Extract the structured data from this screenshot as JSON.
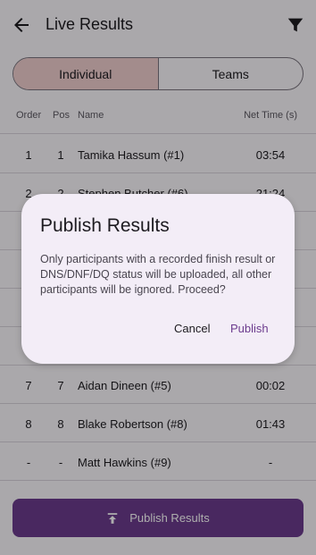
{
  "header": {
    "title": "Live Results"
  },
  "segments": {
    "individual": "Individual",
    "teams": "Teams"
  },
  "table": {
    "headers": {
      "order": "Order",
      "pos": "Pos",
      "name": "Name",
      "time": "Net Time (s)"
    },
    "rows": [
      {
        "order": "1",
        "pos": "1",
        "name": "Tamika Hassum (#1)",
        "time": "03:54"
      },
      {
        "order": "2",
        "pos": "2",
        "name": "Stephen Butcher (#6)",
        "time": "21:24"
      },
      {
        "order": "",
        "pos": "",
        "name": "",
        "time": ""
      },
      {
        "order": "",
        "pos": "",
        "name": "",
        "time": ""
      },
      {
        "order": "",
        "pos": "",
        "name": "",
        "time": ""
      },
      {
        "order": "",
        "pos": "",
        "name": "",
        "time": ""
      },
      {
        "order": "7",
        "pos": "7",
        "name": "Aidan Dineen (#5)",
        "time": "00:02"
      },
      {
        "order": "8",
        "pos": "8",
        "name": "Blake Robertson (#8)",
        "time": "01:43"
      },
      {
        "order": "-",
        "pos": "-",
        "name": "Matt Hawkins (#9)",
        "time": "-"
      }
    ]
  },
  "bottom_button": {
    "label": "Publish Results"
  },
  "dialog": {
    "title": "Publish Results",
    "body": "Only participants with a recorded finish result or DNS/DNF/DQ status will be uploaded, all other participants will be ignored. Proceed?",
    "cancel": "Cancel",
    "confirm": "Publish"
  },
  "colors": {
    "accent": "#6c3c8e",
    "segment_active": "#f0cfcf",
    "dialog_bg": "#f3edf7"
  }
}
